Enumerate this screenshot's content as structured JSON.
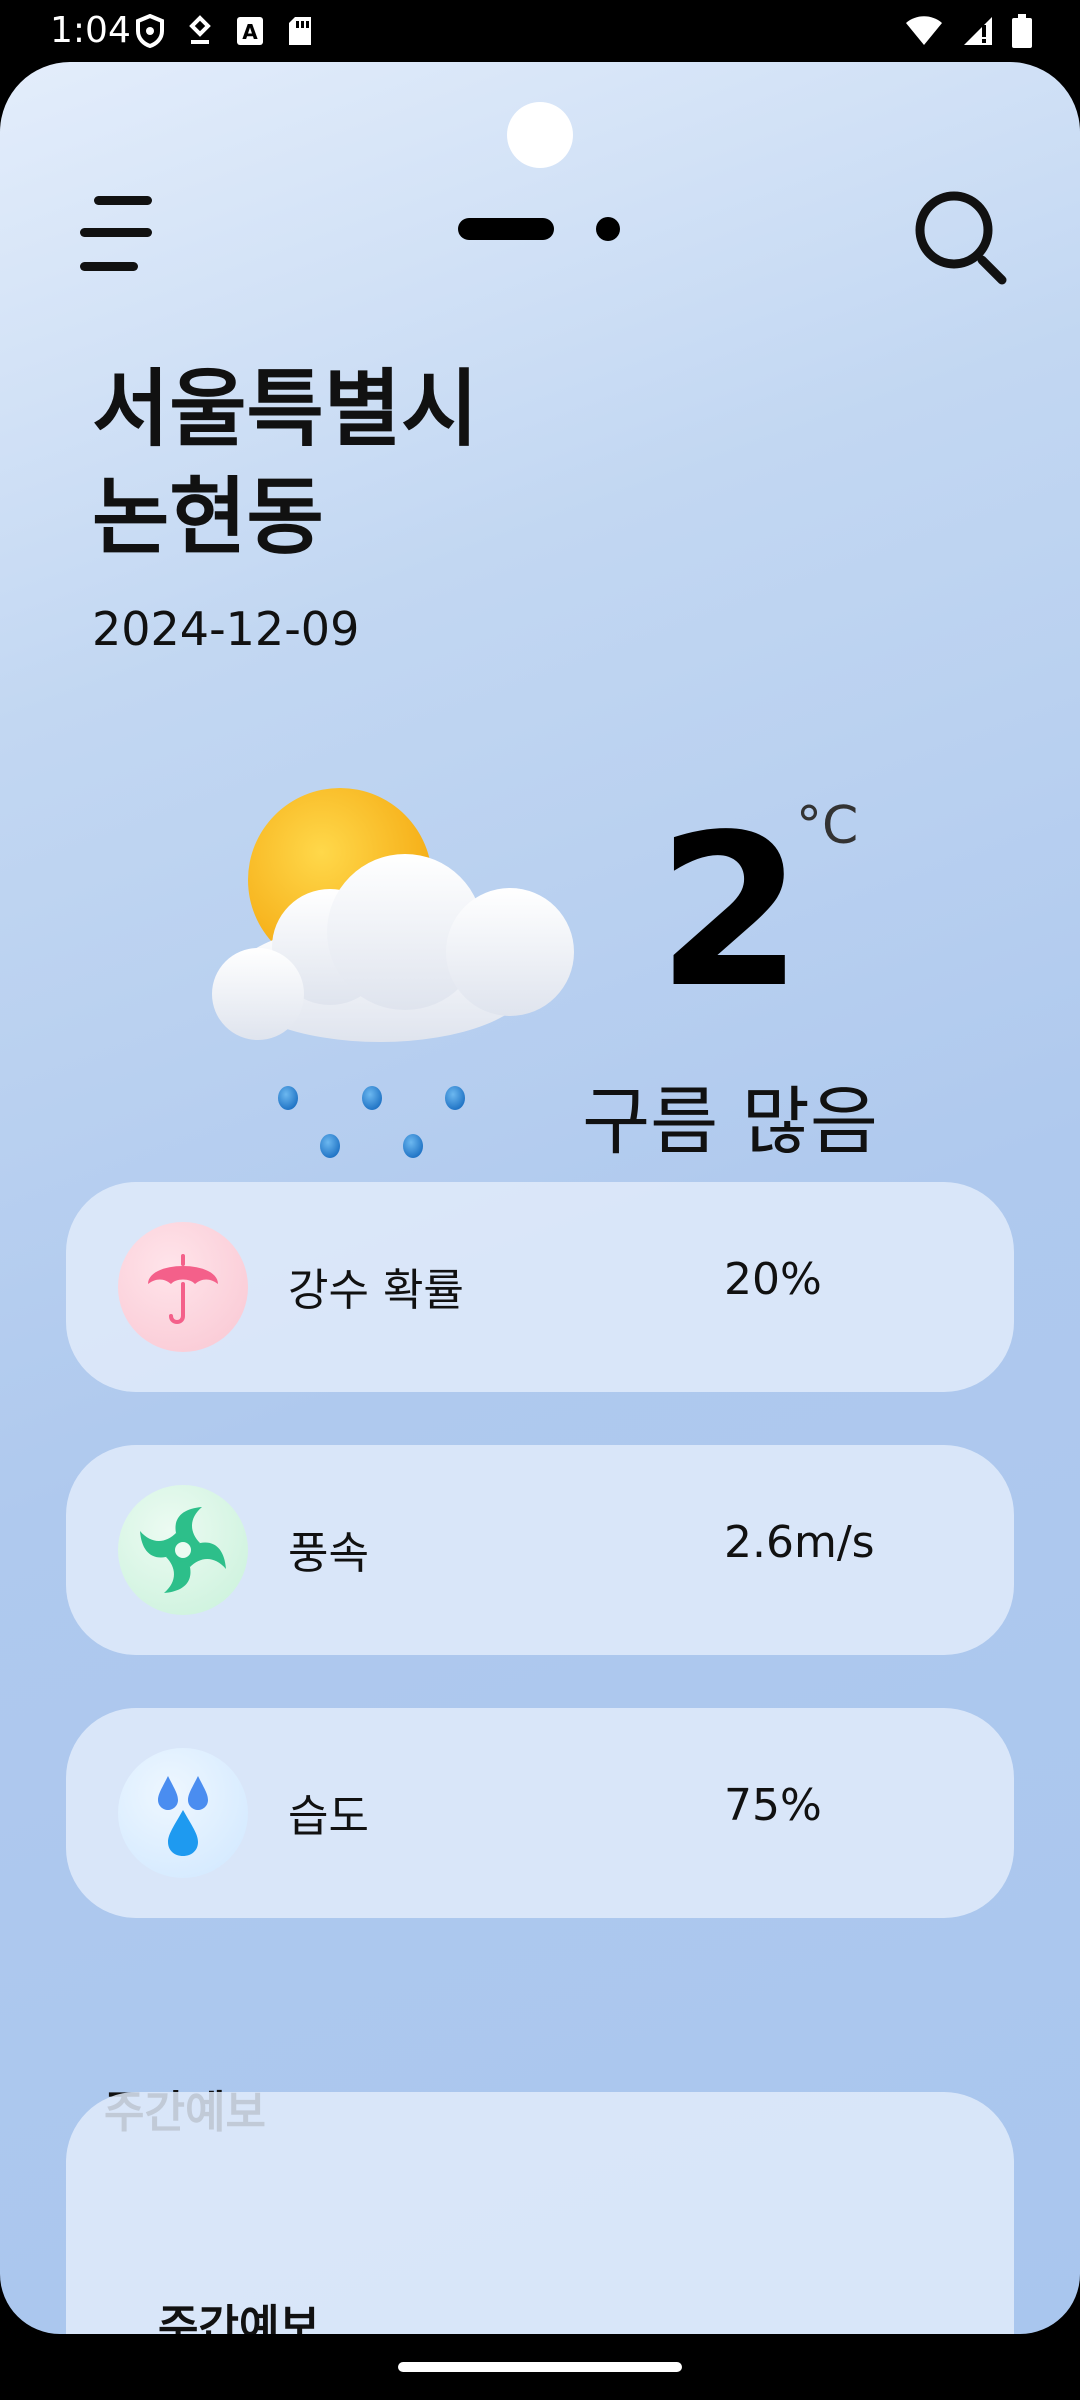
{
  "status_bar": {
    "time": "1:04"
  },
  "header": {
    "menu_icon": "menu-icon",
    "search_icon": "search-icon",
    "page_indicator": "page-indicator"
  },
  "location": {
    "line1": "서울특별시",
    "line2": "논현동"
  },
  "date": "2024-12-09",
  "current": {
    "temperature": "2",
    "unit": "°C",
    "condition": "구름 많음",
    "icon": "sun-cloud-rain-icon"
  },
  "details": [
    {
      "label": "강수 확률",
      "value": "20%",
      "icon": "umbrella-icon",
      "color": "#f4608a"
    },
    {
      "label": "풍속",
      "value": "2.6m/s",
      "icon": "wind-icon",
      "color": "#2dbf8a"
    },
    {
      "label": "습도",
      "value": "75%",
      "icon": "humidity-icon",
      "color": "#2f8ff0"
    }
  ],
  "weekly": {
    "section_title": "주간예보",
    "card_title": "주간예보"
  },
  "colors": {
    "background_top": "#e3edfb",
    "background_bottom": "#a9c6ee",
    "card": "#e1ebfa"
  }
}
